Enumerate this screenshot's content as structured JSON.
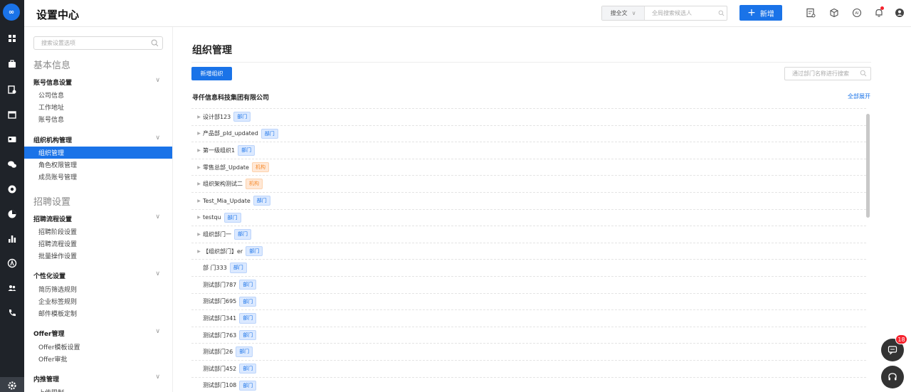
{
  "app": {
    "title": "设置中心",
    "logo_text": "∞"
  },
  "header": {
    "search_scope": "搜全文",
    "search_placeholder": "全局搜索候选人",
    "new_button": "新增",
    "plus": "+"
  },
  "sidebar": {
    "search_placeholder": "搜索设置选项",
    "sections": [
      {
        "title": "基本信息"
      },
      {
        "title": "招聘设置"
      }
    ],
    "groups": [
      {
        "label": "账号信息设置",
        "items": [
          "公司信息",
          "工作地址",
          "账号信息"
        ]
      },
      {
        "label": "组织机构管理",
        "items": [
          "组织管理",
          "角色权限管理",
          "成员账号管理"
        ]
      },
      {
        "label": "招聘流程设置",
        "items": [
          "招聘阶段设置",
          "招聘流程设置",
          "批量操作设置"
        ]
      },
      {
        "label": "个性化设置",
        "items": [
          "简历筛选规则",
          "企业标签规则",
          "邮件模板定制"
        ]
      },
      {
        "label": "Offer管理",
        "items": [
          "Offer模板设置",
          "Offer审批"
        ]
      },
      {
        "label": "内推管理",
        "items": [
          "上传限制"
        ]
      }
    ],
    "active_item": "组织管理"
  },
  "main": {
    "title": "组织管理",
    "add_button": "新增组织",
    "search_placeholder": "通过部门名称进行搜索",
    "company": "寻仟信息科技集团有限公司",
    "expand_all": "全部展开",
    "rows": [
      {
        "name": "设计部123",
        "tag": "部门",
        "type": "dept",
        "expandable": true
      },
      {
        "name": "产品部_pId_updated",
        "tag": "部门",
        "type": "dept",
        "expandable": true
      },
      {
        "name": "第一级组织1",
        "tag": "部门",
        "type": "dept",
        "expandable": true
      },
      {
        "name": "零售总部_Update",
        "tag": "机构",
        "type": "org",
        "expandable": true
      },
      {
        "name": "组织架构测试二",
        "tag": "机构",
        "type": "org",
        "expandable": true
      },
      {
        "name": "Test_Mia_Update",
        "tag": "部门",
        "type": "dept",
        "expandable": true
      },
      {
        "name": "testqu",
        "tag": "部门",
        "type": "dept",
        "expandable": true
      },
      {
        "name": "组织部门一",
        "tag": "部门",
        "type": "dept",
        "expandable": true
      },
      {
        "name": "【组织部门】er",
        "tag": "部门",
        "type": "dept",
        "expandable": true
      },
      {
        "name": "部 门333",
        "tag": "部门",
        "type": "dept",
        "expandable": false
      },
      {
        "name": "测试部门787",
        "tag": "部门",
        "type": "dept",
        "expandable": false
      },
      {
        "name": "测试部门695",
        "tag": "部门",
        "type": "dept",
        "expandable": false
      },
      {
        "name": "测试部门341",
        "tag": "部门",
        "type": "dept",
        "expandable": false
      },
      {
        "name": "测试部门763",
        "tag": "部门",
        "type": "dept",
        "expandable": false
      },
      {
        "name": "测试部门26",
        "tag": "部门",
        "type": "dept",
        "expandable": false
      },
      {
        "name": "测试部门452",
        "tag": "部门",
        "type": "dept",
        "expandable": false
      },
      {
        "name": "测试部门108",
        "tag": "部门",
        "type": "dept",
        "expandable": false
      }
    ]
  },
  "floating": {
    "chat_badge": "18"
  },
  "colors": {
    "accent": "#1a73e8",
    "rail": "#1f2329",
    "dept_tag": "#1a73e8",
    "org_tag": "#f58a2b",
    "notify": "#f5222d"
  }
}
